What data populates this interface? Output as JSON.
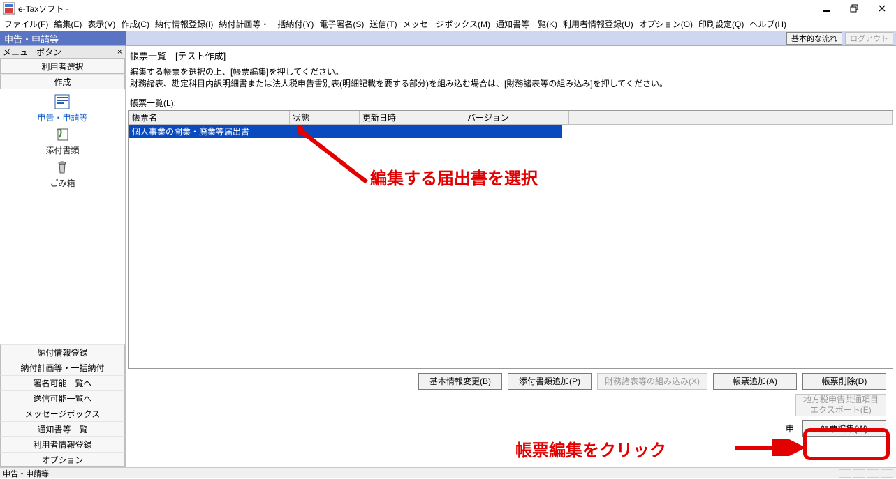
{
  "app": {
    "title": "e-Taxソフト -",
    "win_buttons": {
      "min": "minimize",
      "max": "restore",
      "close": "close"
    }
  },
  "menus": [
    "ファイル(F)",
    "編集(E)",
    "表示(V)",
    "作成(C)",
    "納付情報登録(I)",
    "納付計画等・一括納付(Y)",
    "電子署名(S)",
    "送信(T)",
    "メッセージボックス(M)",
    "通知書等一覧(K)",
    "利用者情報登録(U)",
    "オプション(O)",
    "印刷設定(Q)",
    "ヘルプ(H)"
  ],
  "ribbon": {
    "title": "申告・申請等",
    "basic_flow": "基本的な流れ",
    "logout": "ログアウト"
  },
  "nav": {
    "header": "メニューボタン",
    "close_x": "×",
    "buttons_top": [
      "利用者選択",
      "作成"
    ],
    "icon_items": [
      {
        "name": "declaration",
        "label": "申告・申請等",
        "active": true
      },
      {
        "name": "attach",
        "label": "添付書類",
        "active": false
      },
      {
        "name": "trash",
        "label": "ごみ箱",
        "active": false
      }
    ],
    "buttons_bottom": [
      "納付情報登録",
      "納付計画等・一括納付",
      "署名可能一覧へ",
      "送信可能一覧へ",
      "メッセージボックス",
      "通知書等一覧",
      "利用者情報登録",
      "オプション"
    ]
  },
  "content": {
    "title": "帳票一覧　[テスト作成]",
    "instr_line1": "編集する帳票を選択の上、[帳票編集]を押してください。",
    "instr_line2": "財務諸表、勘定科目内訳明細書または法人税申告書別表(明細記載を要する部分)を組み込む場合は、[財務諸表等の組み込み]を押してください。",
    "list_label": "帳票一覧(L):",
    "columns": [
      "帳票名",
      "状態",
      "更新日時",
      "バージョン",
      ""
    ],
    "rows": [
      {
        "name": "個人事業の開業・廃業等届出書",
        "state": "",
        "updated": "",
        "version": ""
      }
    ],
    "btn_row1": [
      {
        "key": "basic_info",
        "label": "基本情報変更(B)",
        "u": "B",
        "enabled": true
      },
      {
        "key": "add_attach",
        "label": "添付書類追加(P)",
        "u": "P",
        "enabled": true
      },
      {
        "key": "import_fs",
        "label": "財務諸表等の組み込み(X)",
        "u": "X",
        "enabled": false
      },
      {
        "key": "add_form",
        "label": "帳票追加(A)",
        "u": "A",
        "enabled": true
      },
      {
        "key": "del_form",
        "label": "帳票削除(D)",
        "u": "D",
        "enabled": true
      }
    ],
    "btn_row2": [
      {
        "key": "export_local",
        "label": "地方税申告共通項目\nエクスポート(E)",
        "u": "E",
        "enabled": false
      }
    ],
    "btn_row3": [
      {
        "key": "edit_form",
        "label": "帳票編集(W)",
        "u": "W",
        "enabled": true
      }
    ],
    "row3_prefix": "申"
  },
  "status": {
    "text": "申告・申請等"
  },
  "annotations": {
    "select_hint": "編集する届出書を選択",
    "click_hint": "帳票編集をクリック"
  }
}
